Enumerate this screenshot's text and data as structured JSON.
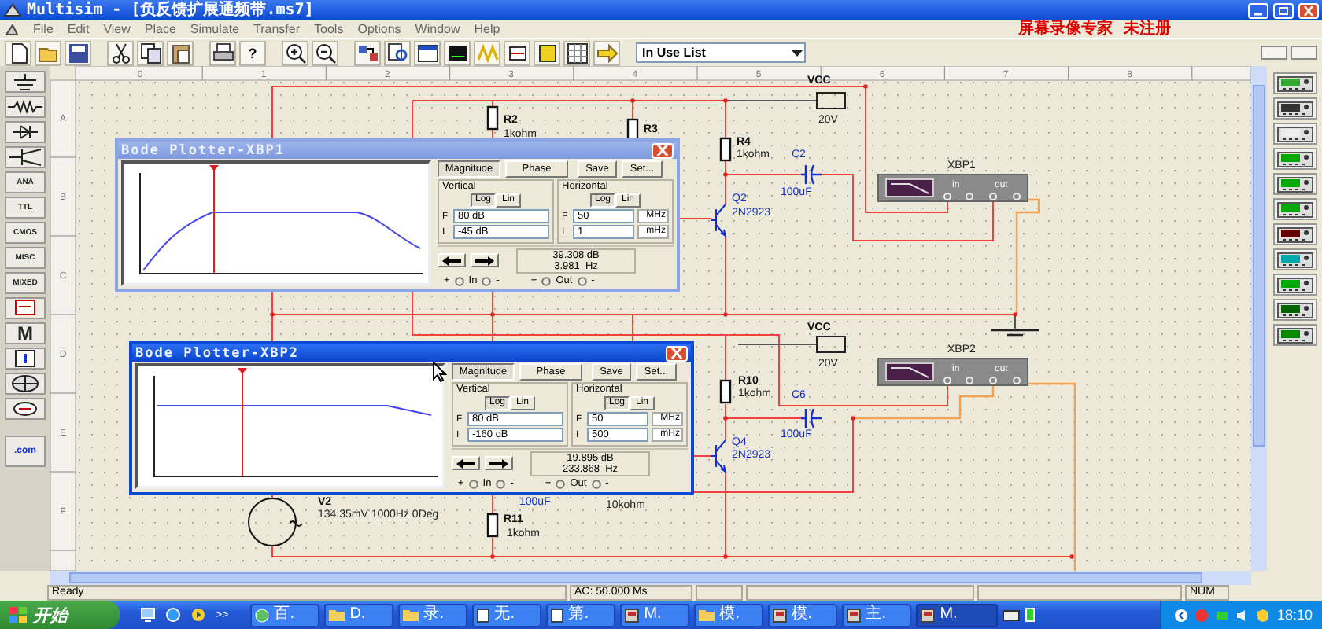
{
  "window": {
    "title": "Multisim - [负反馈扩展通频带.ms7]"
  },
  "menu": [
    "File",
    "Edit",
    "View",
    "Place",
    "Simulate",
    "Transfer",
    "Tools",
    "Options",
    "Window",
    "Help"
  ],
  "recorder_notice": "屏幕录像专家  未注册",
  "toolbar": {
    "help": "?",
    "component_list": "In Use List"
  },
  "component_bar_labels": [
    "ANA",
    "TTL",
    "CMOS",
    "MISC",
    "MIXED",
    "M",
    ".com"
  ],
  "ruler": {
    "columns": [
      "0",
      "1",
      "2",
      "3",
      "4",
      "5",
      "6",
      "7",
      "8"
    ],
    "rows": [
      "A",
      "B",
      "C",
      "D",
      "E",
      "F"
    ]
  },
  "schematic": {
    "labels": [
      {
        "text": "VCC",
        "kind": "ref"
      },
      {
        "text": "20V",
        "kind": "value"
      },
      {
        "text": "R2",
        "kind": "ref"
      },
      {
        "text": "1kohm",
        "kind": "value"
      },
      {
        "text": "R3",
        "kind": "ref"
      },
      {
        "text": "R4",
        "kind": "ref"
      },
      {
        "text": "1kohm",
        "kind": "value"
      },
      {
        "text": "C2",
        "kind": "part"
      },
      {
        "text": "100uF",
        "kind": "part"
      },
      {
        "text": "Q2",
        "kind": "part"
      },
      {
        "text": "2N2923",
        "kind": "part"
      },
      {
        "text": "VCC",
        "kind": "ref"
      },
      {
        "text": "20V",
        "kind": "value"
      },
      {
        "text": "R10",
        "kind": "ref"
      },
      {
        "text": "1kohm",
        "kind": "value"
      },
      {
        "text": "C6",
        "kind": "part"
      },
      {
        "text": "100uF",
        "kind": "part"
      },
      {
        "text": "Q4",
        "kind": "part"
      },
      {
        "text": "2N2923",
        "kind": "part"
      },
      {
        "text": "V2",
        "kind": "ref"
      },
      {
        "text": "134.35mV 1000Hz 0Deg",
        "kind": "value"
      },
      {
        "text": "100uF",
        "kind": "part"
      },
      {
        "text": "10kohm",
        "kind": "value"
      },
      {
        "text": "R11",
        "kind": "ref"
      },
      {
        "text": "1kohm",
        "kind": "value"
      }
    ],
    "instruments": [
      {
        "name": "XBP1",
        "in_label": "in",
        "out_label": "out"
      },
      {
        "name": "XBP2",
        "in_label": "in",
        "out_label": "out"
      }
    ]
  },
  "bode_plotters": [
    {
      "title": "Bode Plotter-XBP1",
      "active": false,
      "modes": [
        {
          "label": "Magnitude",
          "selected": true
        },
        {
          "label": "Phase",
          "selected": false
        }
      ],
      "save": "Save",
      "set": "Set...",
      "vertical": {
        "title": "Vertical",
        "scales": [
          {
            "label": "Log",
            "selected": true
          },
          {
            "label": "Lin",
            "selected": false
          }
        ],
        "final_label": "F",
        "final": "80 dB",
        "initial_label": "I",
        "initial": "-45 dB"
      },
      "horizontal": {
        "title": "Horizontal",
        "scales": [
          {
            "label": "Log",
            "selected": true
          },
          {
            "label": "Lin",
            "selected": false
          }
        ],
        "final_label": "F",
        "final": "50",
        "final_unit": "MHz",
        "initial_label": "I",
        "initial": "1",
        "initial_unit": "mHz"
      },
      "readout": [
        "39.308 dB",
        "3.981  Hz"
      ],
      "terminals": [
        {
          "plus": "+",
          "label": "In",
          "minus": "-"
        },
        {
          "plus": "+",
          "label": "Out",
          "minus": "-"
        }
      ]
    },
    {
      "title": "Bode Plotter-XBP2",
      "active": true,
      "modes": [
        {
          "label": "Magnitude",
          "selected": true
        },
        {
          "label": "Phase",
          "selected": false
        }
      ],
      "save": "Save",
      "set": "Set...",
      "vertical": {
        "title": "Vertical",
        "scales": [
          {
            "label": "Log",
            "selected": true
          },
          {
            "label": "Lin",
            "selected": false
          }
        ],
        "final_label": "F",
        "final": "80 dB",
        "initial_label": "I",
        "initial": "-160 dB"
      },
      "horizontal": {
        "title": "Horizontal",
        "scales": [
          {
            "label": "Log",
            "selected": true
          },
          {
            "label": "Lin",
            "selected": false
          }
        ],
        "final_label": "F",
        "final": "50",
        "final_unit": "MHz",
        "initial_label": "I",
        "initial": "500",
        "initial_unit": "mHz"
      },
      "readout": [
        "19.895 dB",
        "233.868  Hz"
      ],
      "terminals": [
        {
          "plus": "+",
          "label": "In",
          "minus": "-"
        },
        {
          "plus": "+",
          "label": "Out",
          "minus": "-"
        }
      ]
    }
  ],
  "status_bar": {
    "message": "Ready",
    "analysis": "AC: 50.000 Ms",
    "num_lock": "NUM"
  },
  "taskbar": {
    "start": "开始",
    "more": ">>",
    "tasks": [
      {
        "label": "百.",
        "selected": false
      },
      {
        "label": "D.",
        "selected": false
      },
      {
        "label": "录.",
        "selected": false
      },
      {
        "label": "无.",
        "selected": false
      },
      {
        "label": "第.",
        "selected": false
      },
      {
        "label": "M.",
        "selected": false
      },
      {
        "label": "模.",
        "selected": false
      },
      {
        "label": "模.",
        "selected": false
      },
      {
        "label": "主.",
        "selected": false
      },
      {
        "label": "M.",
        "selected": true
      }
    ],
    "clock": "18:10"
  }
}
